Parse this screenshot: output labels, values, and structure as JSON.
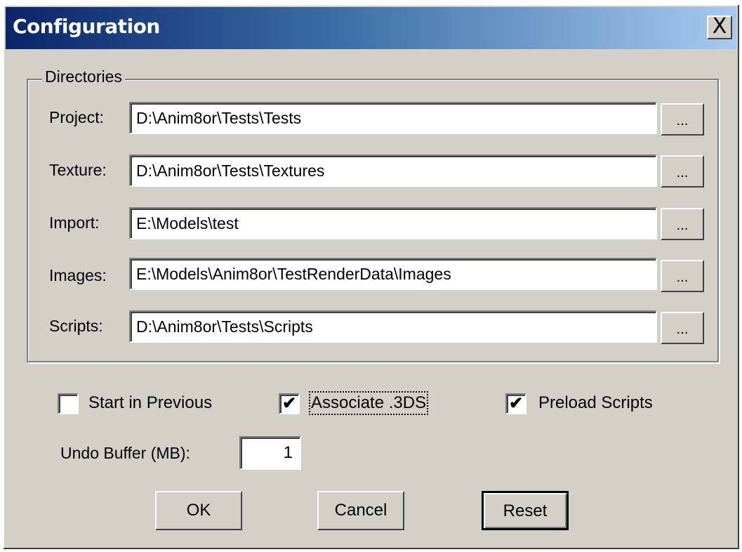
{
  "window": {
    "title": "Configuration",
    "close_glyph": "X"
  },
  "directories": {
    "group_label": "Directories",
    "rows": [
      {
        "label": "Project:",
        "value": "D:\\Anim8or\\Tests\\Tests",
        "browse": "..."
      },
      {
        "label": "Texture:",
        "value": "D:\\Anim8or\\Tests\\Textures",
        "browse": "..."
      },
      {
        "label": "Import:",
        "value": "E:\\Models\\test",
        "browse": "..."
      },
      {
        "label": "Images:",
        "value": "E:\\Models\\Anim8or\\TestRenderData\\Images",
        "browse": "..."
      },
      {
        "label": "Scripts:",
        "value": "D:\\Anim8or\\Tests\\Scripts",
        "browse": "..."
      }
    ]
  },
  "options": {
    "start_in_previous": {
      "label": "Start in Previous",
      "checked": false,
      "mark": ""
    },
    "associate_3ds": {
      "label": "Associate .3DS",
      "checked": true,
      "mark": "✔"
    },
    "preload_scripts": {
      "label": "Preload Scripts",
      "checked": true,
      "mark": "✔"
    }
  },
  "undo_buffer": {
    "label": "Undo Buffer (MB):",
    "value": "1"
  },
  "buttons": {
    "ok": "OK",
    "cancel": "Cancel",
    "reset": "Reset"
  }
}
